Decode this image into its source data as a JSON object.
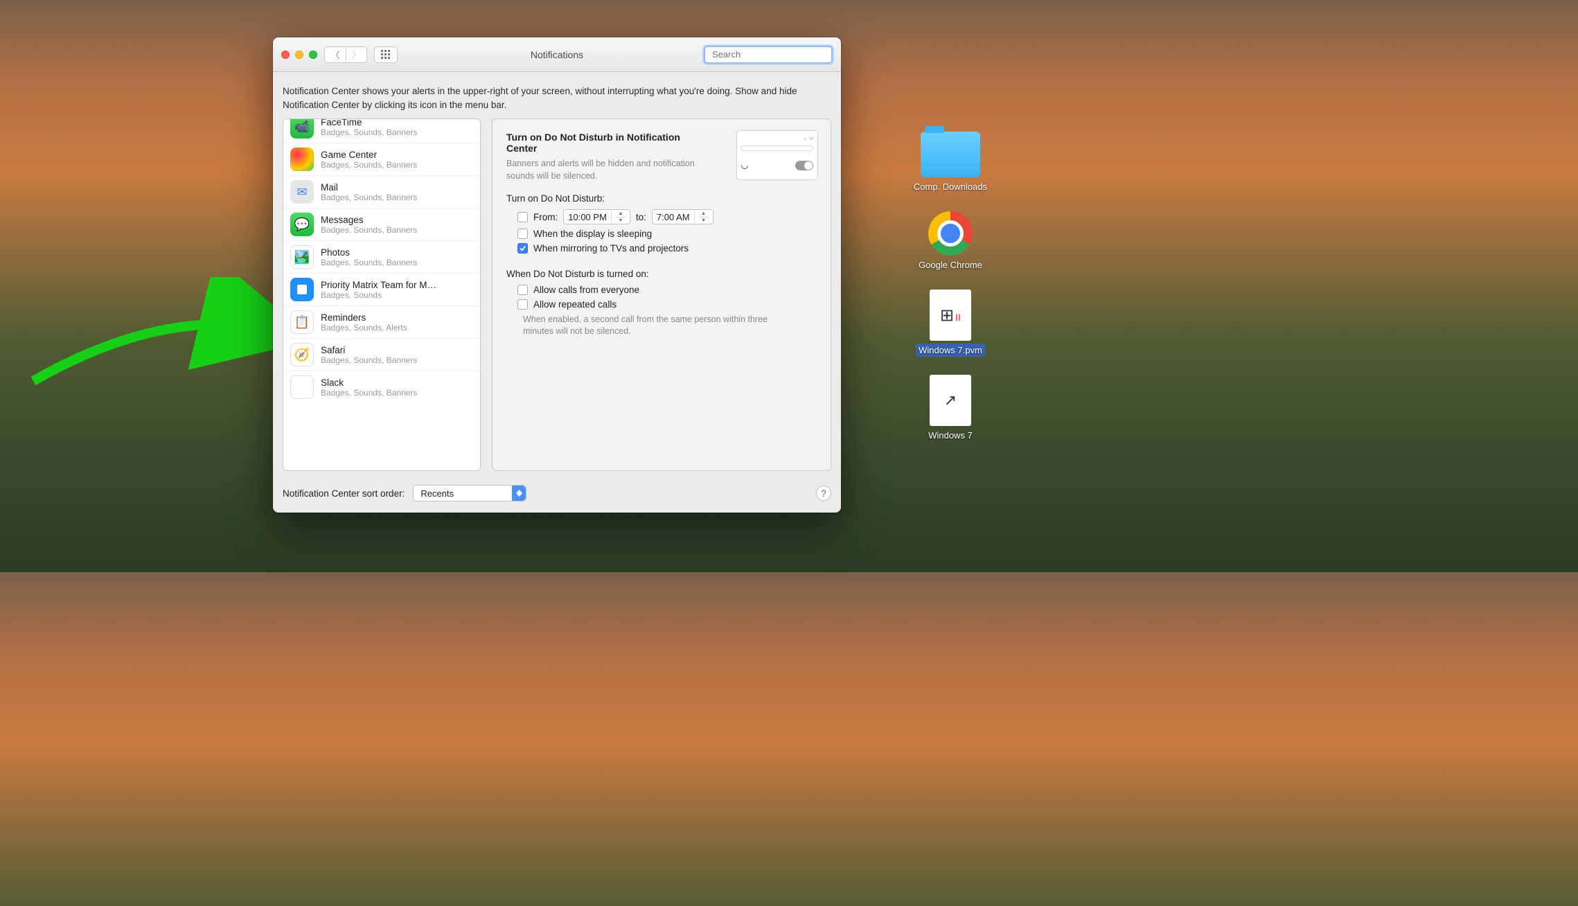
{
  "window": {
    "title": "Notifications",
    "search_placeholder": "Search",
    "description": "Notification Center shows your alerts in the upper-right of your screen, without interrupting what you're doing. Show and hide Notification Center by clicking its icon in the menu bar."
  },
  "apps": [
    {
      "name": "FaceTime",
      "sub": "Badges, Sounds, Banners",
      "icon": "facetime"
    },
    {
      "name": "Game Center",
      "sub": "Badges, Sounds, Banners",
      "icon": "gamecenter"
    },
    {
      "name": "Mail",
      "sub": "Badges, Sounds, Banners",
      "icon": "mail"
    },
    {
      "name": "Messages",
      "sub": "Badges, Sounds, Banners",
      "icon": "messages"
    },
    {
      "name": "Photos",
      "sub": "Badges, Sounds, Banners",
      "icon": "photos"
    },
    {
      "name": "Priority Matrix Team for M…",
      "sub": "Badges, Sounds",
      "icon": "pm"
    },
    {
      "name": "Reminders",
      "sub": "Badges, Sounds, Alerts",
      "icon": "reminders"
    },
    {
      "name": "Safari",
      "sub": "Badges, Sounds, Banners",
      "icon": "safari"
    },
    {
      "name": "Slack",
      "sub": "Badges, Sounds, Banners",
      "icon": "slack"
    }
  ],
  "panel": {
    "title": "Turn on Do Not Disturb in Notification Center",
    "subtitle": "Banners and alerts will be hidden and notification sounds will be silenced.",
    "schedule_label": "Turn on Do Not Disturb:",
    "from_label": "From:",
    "to_label": "to:",
    "time_from": "10:00 PM",
    "time_to": "7:00 AM",
    "opt_sleep": "When the display is sleeping",
    "opt_mirror": "When mirroring to TVs and projectors",
    "when_on_title": "When Do Not Disturb is turned on:",
    "opt_everyone": "Allow calls from everyone",
    "opt_repeated": "Allow repeated calls",
    "repeated_hint": "When enabled, a second call from the same person within three minutes will not be silenced."
  },
  "footer": {
    "label": "Notification Center sort order:",
    "value": "Recents"
  },
  "desktop": {
    "folder": "Comp. Downloads",
    "chrome": "Google Chrome",
    "pvm": "Windows 7.pvm",
    "win7": "Windows 7"
  }
}
